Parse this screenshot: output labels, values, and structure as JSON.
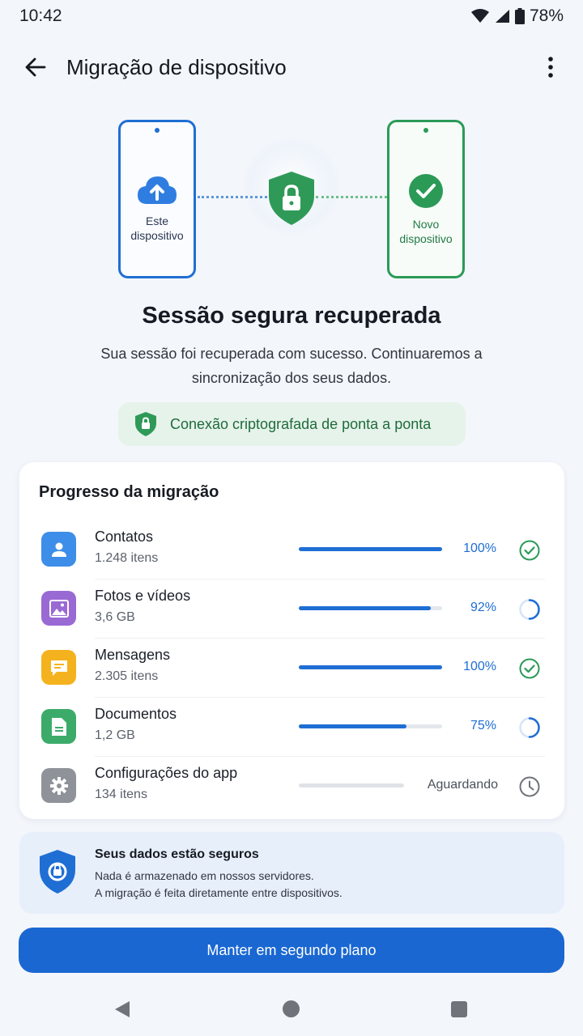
{
  "status_bar": {
    "time": "10:42",
    "battery": "78%"
  },
  "app_bar": {
    "title": "Migração de dispositivo"
  },
  "hero": {
    "left_label": "Este dispositivo",
    "right_label": "Novo dispositivo"
  },
  "headline": "Sessão segura recuperada",
  "subtext": "Sua sessão foi recuperada com sucesso. Continuaremos a sincronização dos seus dados.",
  "secure_pill": "Conexão criptografada de ponta a ponta",
  "progress": {
    "title": "Progresso da migração",
    "items": [
      {
        "name": "Contatos",
        "detail": "1.248 itens",
        "status_text": "100%",
        "progress": 1.0,
        "state": "done",
        "icon": "contact-icon",
        "color": "#3d8ee8"
      },
      {
        "name": "Fotos e vídeos",
        "detail": "3,6 GB",
        "status_text": "92%",
        "progress": 0.92,
        "state": "in-progress",
        "icon": "photo-icon",
        "color": "#9a6ad4"
      },
      {
        "name": "Mensagens",
        "detail": "2.305 itens",
        "status_text": "100%",
        "progress": 1.0,
        "state": "done",
        "icon": "message-icon",
        "color": "#f5b21f"
      },
      {
        "name": "Documentos",
        "detail": "1,2 GB",
        "status_text": "75%",
        "progress": 0.75,
        "state": "in-progress",
        "icon": "document-icon",
        "color": "#3cab6a"
      },
      {
        "name": "Configurações do app",
        "detail": "134 itens",
        "status_text": "Aguardando",
        "progress": 0,
        "state": "waiting",
        "icon": "gear-icon",
        "color": "#8f9399"
      }
    ]
  },
  "safe_card": {
    "title": "Seus dados estão seguros",
    "line1": "Nada é armazenado em nossos servidores.",
    "line2": "A migração é feita diretamente entre dispositivos."
  },
  "cta": "Manter em segundo plano",
  "colors": {
    "primary": "#1f6ed4",
    "success": "#2b9a57"
  }
}
